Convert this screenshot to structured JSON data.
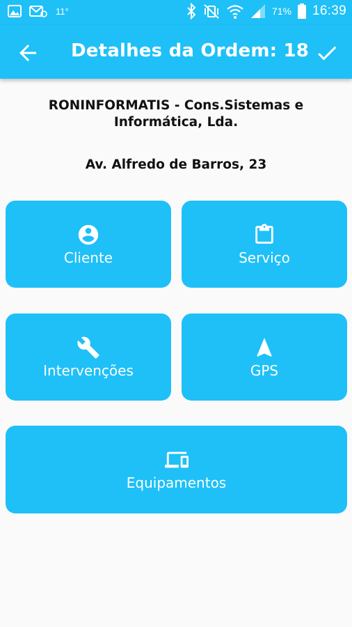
{
  "statusbar": {
    "temperature": "11°",
    "battery": "71%",
    "time": "16:39"
  },
  "appbar": {
    "title": "Detalhes da Ordem: 18"
  },
  "order": {
    "company": "RONINFORMATIS - Cons.Sistemas e Informática, Lda.",
    "address": "Av. Alfredo de Barros, 23"
  },
  "tiles": {
    "cliente": "Cliente",
    "servico": "Serviço",
    "intervencoes": "Intervenções",
    "gps": "GPS",
    "equipamentos": "Equipamentos"
  },
  "colors": {
    "accent": "#1ec0f7",
    "background": "#fafafa"
  }
}
